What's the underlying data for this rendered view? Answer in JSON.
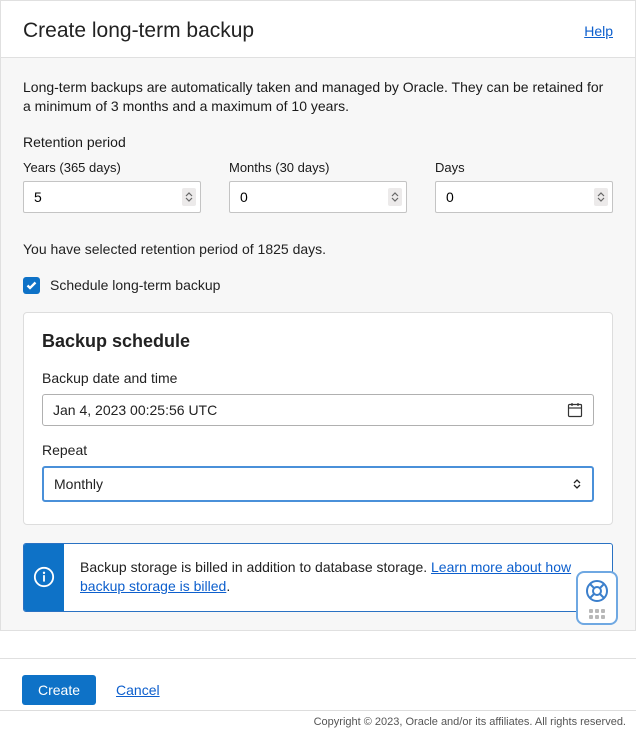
{
  "header": {
    "title": "Create long-term backup",
    "help": "Help"
  },
  "intro": "Long-term backups are automatically taken and managed by Oracle. They can be retained for a minimum of 3 months and a maximum of 10 years.",
  "retention": {
    "label": "Retention period",
    "years_label": "Years (365 days)",
    "months_label": "Months (30 days)",
    "days_label": "Days",
    "years": "5",
    "months": "0",
    "days": "0",
    "summary": "You have selected retention period of 1825 days."
  },
  "schedule_checkbox": "Schedule long-term backup",
  "schedule": {
    "title": "Backup schedule",
    "date_label": "Backup date and time",
    "date_value": "Jan 4, 2023 00:25:56 UTC",
    "repeat_label": "Repeat",
    "repeat_value": "Monthly"
  },
  "info": {
    "text1": "Backup storage is billed in addition to database storage. ",
    "link": "Learn more about how backup storage is billed",
    "period": "."
  },
  "footer": {
    "create": "Create",
    "cancel": "Cancel"
  },
  "copyright": "Copyright © 2023, Oracle and/or its affiliates. All rights reserved."
}
